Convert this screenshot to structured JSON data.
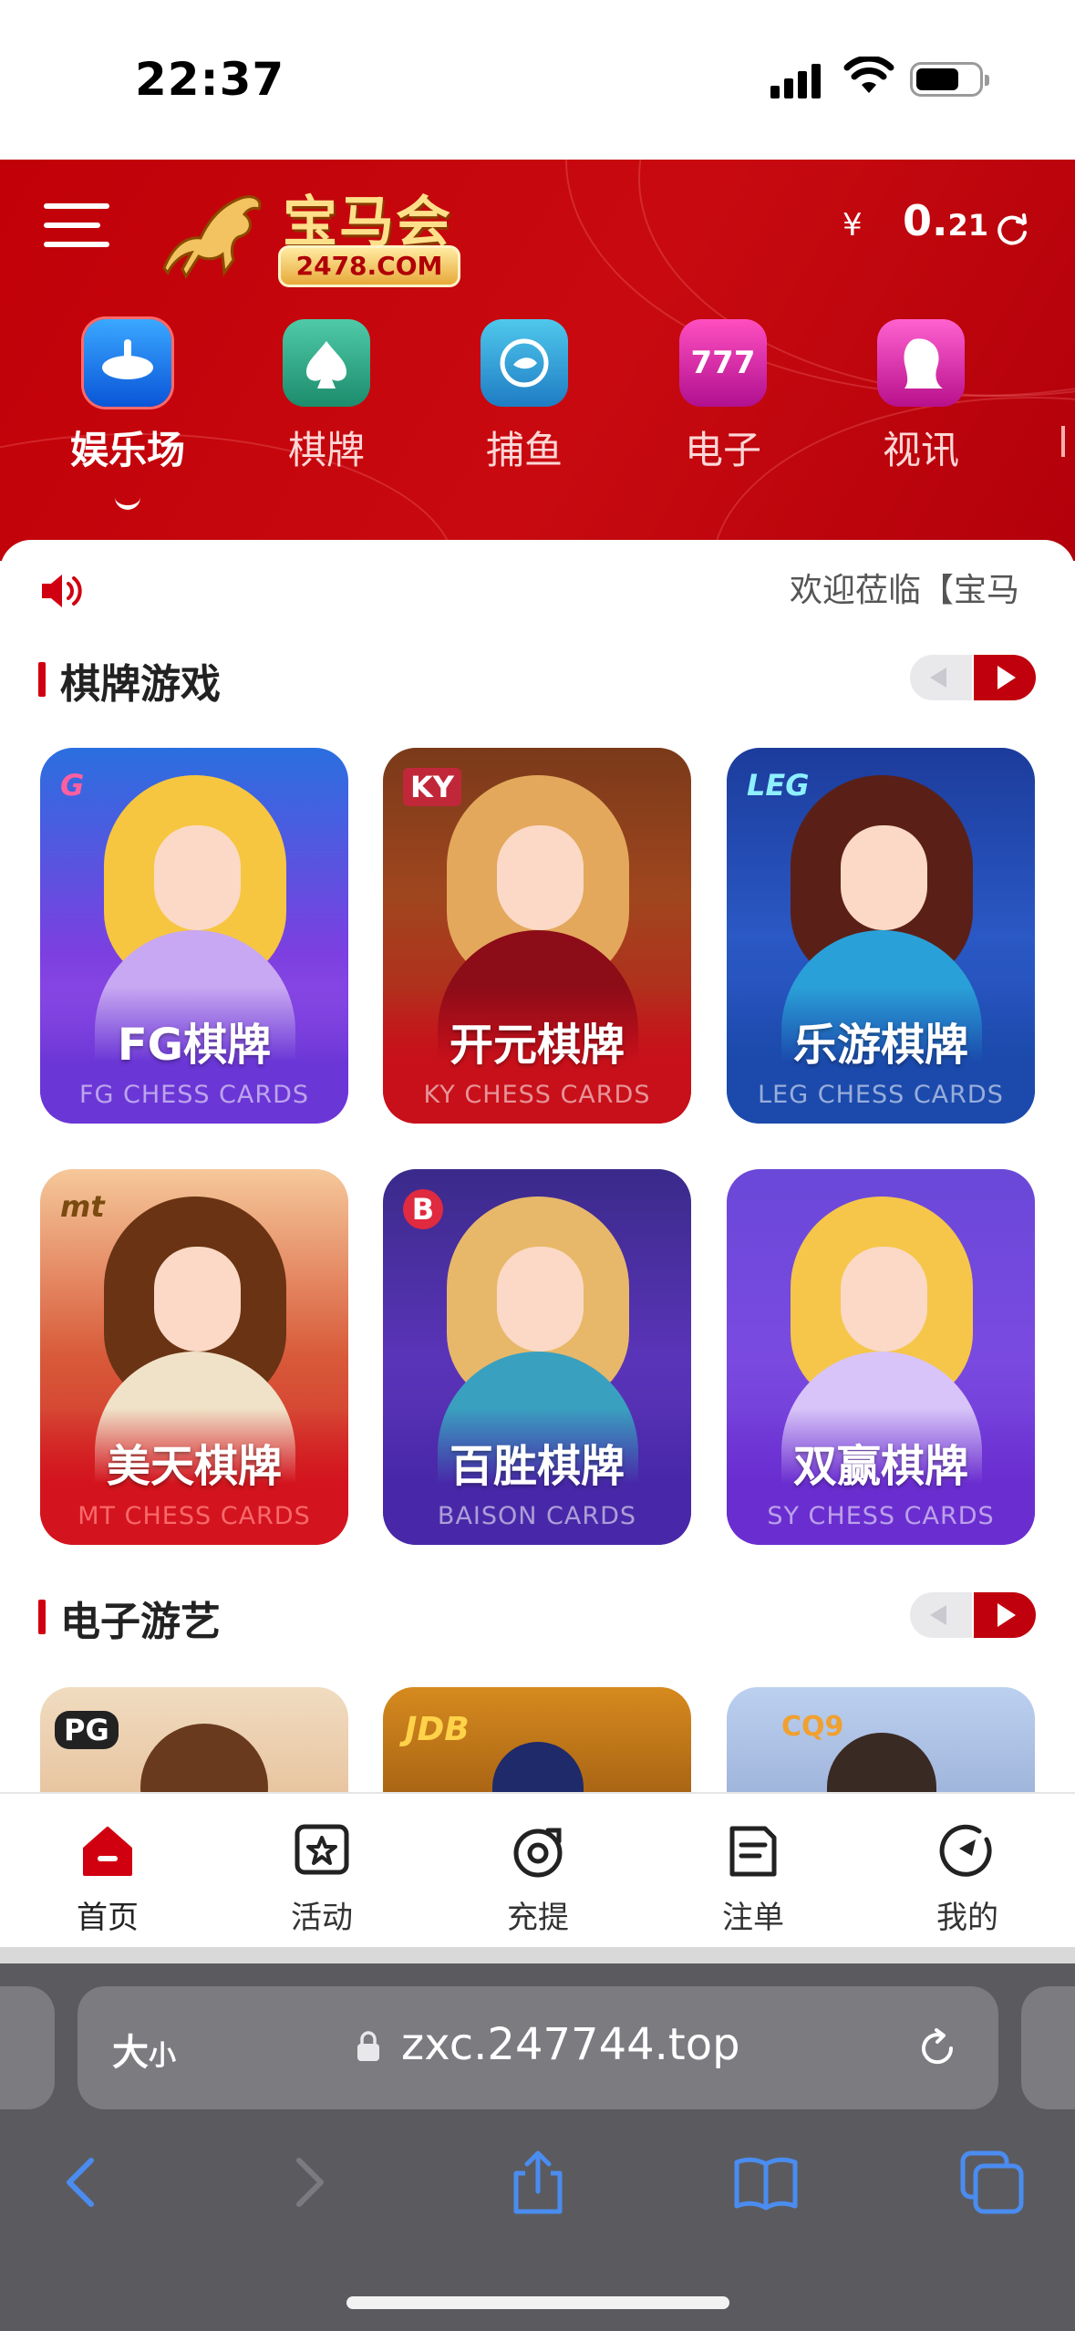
{
  "status_bar": {
    "time": "22:37"
  },
  "header": {
    "logo_text": "宝马会",
    "logo_domain": "2478.COM",
    "currency_symbol": "¥",
    "balance_main": "0.",
    "balance_cents": "21"
  },
  "categories": [
    {
      "label": "娱乐场",
      "icon": "roulette-icon",
      "active": true
    },
    {
      "label": "棋牌",
      "icon": "spade-icon",
      "active": false
    },
    {
      "label": "捕鱼",
      "icon": "fish-icon",
      "active": false
    },
    {
      "label": "电子",
      "icon": "slot-777-icon",
      "active": false
    },
    {
      "label": "视讯",
      "icon": "live-dealer-icon",
      "active": false
    }
  ],
  "marquee_text": "欢迎莅临【宝马",
  "sections": {
    "chess": {
      "title": "棋牌游戏"
    },
    "slots": {
      "title": "电子游艺"
    }
  },
  "chess_games": [
    {
      "title": "FG棋牌",
      "subtitle": "FG CHESS CARDS",
      "badge": "G"
    },
    {
      "title": "开元棋牌",
      "subtitle": "KY CHESS CARDS",
      "badge": "KY"
    },
    {
      "title": "乐游棋牌",
      "subtitle": "LEG CHESS CARDS",
      "badge": "LEG"
    },
    {
      "title": "美天棋牌",
      "subtitle": "MT CHESS CARDS",
      "badge": "mt"
    },
    {
      "title": "百胜棋牌",
      "subtitle": "BAISON CARDS",
      "badge": "B"
    },
    {
      "title": "双赢棋牌",
      "subtitle": "SY CHESS CARDS",
      "badge": ""
    }
  ],
  "slot_games": [
    {
      "badge": "PG"
    },
    {
      "badge": "JDB"
    },
    {
      "badge": "CQ9"
    }
  ],
  "bottom_nav": [
    {
      "label": "首页",
      "icon": "home-icon"
    },
    {
      "label": "活动",
      "icon": "activity-star-icon"
    },
    {
      "label": "充提",
      "icon": "deposit-withdraw-icon"
    },
    {
      "label": "注单",
      "icon": "bet-slip-icon"
    },
    {
      "label": "我的",
      "icon": "profile-icon"
    }
  ],
  "browser": {
    "text_size_label": "大",
    "text_size_small": "小",
    "url": "zxc.247744.top"
  },
  "colors": {
    "brand_red": "#c10008",
    "accent_gold": "#ffe08a",
    "safari_bg": "#5b5b5f",
    "link_blue": "#4a8cf0"
  }
}
